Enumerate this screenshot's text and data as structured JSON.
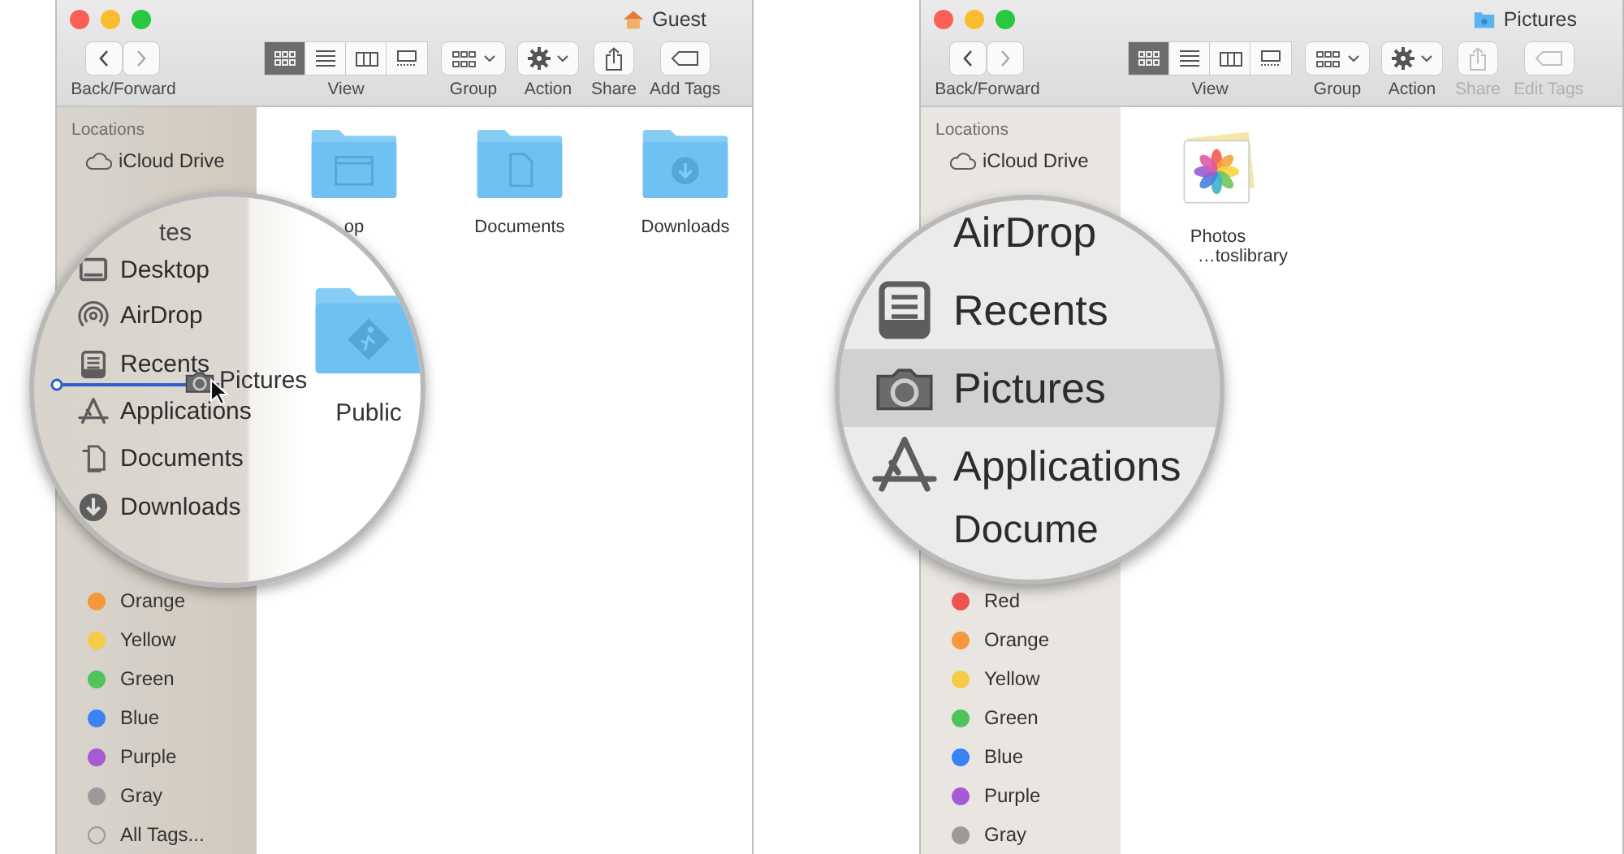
{
  "panels": [
    {
      "title": {
        "text": "Guest",
        "kind": "home"
      },
      "toolbar": {
        "nav_label": "Back/Forward",
        "view_label": "View",
        "view_modes": [
          {
            "kind": "icons",
            "selected": true
          },
          {
            "kind": "list",
            "selected": false
          },
          {
            "kind": "columns",
            "selected": false
          },
          {
            "kind": "gallery",
            "selected": false
          }
        ],
        "buttons": [
          {
            "kind": "group",
            "label": "Group",
            "disabled": false
          },
          {
            "kind": "action",
            "label": "Action",
            "disabled": false
          },
          {
            "kind": "share",
            "label": "Share",
            "disabled": false
          },
          {
            "kind": "tags",
            "label": "Add Tags",
            "disabled": false
          }
        ]
      },
      "sidebar": {
        "heading": "Locations",
        "locations": [
          {
            "label": "iCloud Drive",
            "kind": "cloud"
          }
        ],
        "tags": [
          {
            "kind": "color",
            "label": "Orange",
            "color": "#f59a3b"
          },
          {
            "kind": "color",
            "label": "Yellow",
            "color": "#f5cc46"
          },
          {
            "kind": "color",
            "label": "Green",
            "color": "#50c35a"
          },
          {
            "kind": "color",
            "label": "Blue",
            "color": "#3b82f6"
          },
          {
            "kind": "color",
            "label": "Purple",
            "color": "#a55bd6"
          },
          {
            "kind": "color",
            "label": "Gray",
            "color": "#9a9a9a"
          },
          {
            "kind": "all",
            "label": "All Tags..."
          }
        ]
      },
      "files": [
        {
          "label": "op",
          "kind": "window"
        },
        {
          "label": "Documents",
          "kind": "doc"
        },
        {
          "label": "Downloads",
          "kind": "download"
        }
      ],
      "magnifier": {
        "kind": "drag",
        "heading": "tes",
        "items": [
          {
            "label": "Desktop",
            "kind": "desktop",
            "selected": false
          },
          {
            "label": "AirDrop",
            "kind": "airdrop",
            "selected": false
          },
          {
            "label": "Recents",
            "kind": "recents",
            "selected": false
          },
          {
            "label": "Applications",
            "kind": "applications",
            "selected": false
          },
          {
            "label": "Documents",
            "kind": "documents",
            "selected": false
          },
          {
            "label": "Downloads",
            "kind": "downloads",
            "selected": false
          }
        ],
        "drag_label": "Pictures",
        "file": {
          "label": "Public",
          "kind": "walk"
        }
      }
    },
    {
      "title": {
        "text": "Pictures",
        "kind": "folder"
      },
      "toolbar": {
        "nav_label": "Back/Forward",
        "view_label": "View",
        "view_modes": [
          {
            "kind": "icons",
            "selected": true
          },
          {
            "kind": "list",
            "selected": false
          },
          {
            "kind": "columns",
            "selected": false
          },
          {
            "kind": "gallery",
            "selected": false
          }
        ],
        "buttons": [
          {
            "kind": "group",
            "label": "Group",
            "disabled": false
          },
          {
            "kind": "action",
            "label": "Action",
            "disabled": false
          },
          {
            "kind": "share",
            "label": "Share",
            "disabled": true
          },
          {
            "kind": "tags",
            "label": "Edit Tags",
            "disabled": true
          }
        ]
      },
      "sidebar": {
        "heading": "Locations",
        "locations": [
          {
            "label": "iCloud Drive",
            "kind": "cloud"
          }
        ],
        "tags": [
          {
            "kind": "color",
            "label": "Red",
            "color": "#ef5350"
          },
          {
            "kind": "color",
            "label": "Orange",
            "color": "#f59a3b"
          },
          {
            "kind": "color",
            "label": "Yellow",
            "color": "#f5cc46"
          },
          {
            "kind": "color",
            "label": "Green",
            "color": "#50c35a"
          },
          {
            "kind": "color",
            "label": "Blue",
            "color": "#3b82f6"
          },
          {
            "kind": "color",
            "label": "Purple",
            "color": "#a55bd6"
          },
          {
            "kind": "color",
            "label": "Gray",
            "color": "#9a9a9a"
          }
        ]
      },
      "files": [
        {
          "label": "Photos",
          "sublabel": "…toslibrary",
          "kind": "photos"
        }
      ],
      "magnifier": {
        "kind": "zoom",
        "items": [
          {
            "label": "AirDrop",
            "kind": "cut",
            "selected": false
          },
          {
            "label": "Recents",
            "kind": "recents",
            "selected": false
          },
          {
            "label": "Pictures",
            "kind": "camera",
            "selected": true
          },
          {
            "label": "Applications",
            "kind": "applications",
            "selected": false
          },
          {
            "label": "Docume",
            "kind": "cut",
            "selected": false
          }
        ]
      }
    }
  ]
}
